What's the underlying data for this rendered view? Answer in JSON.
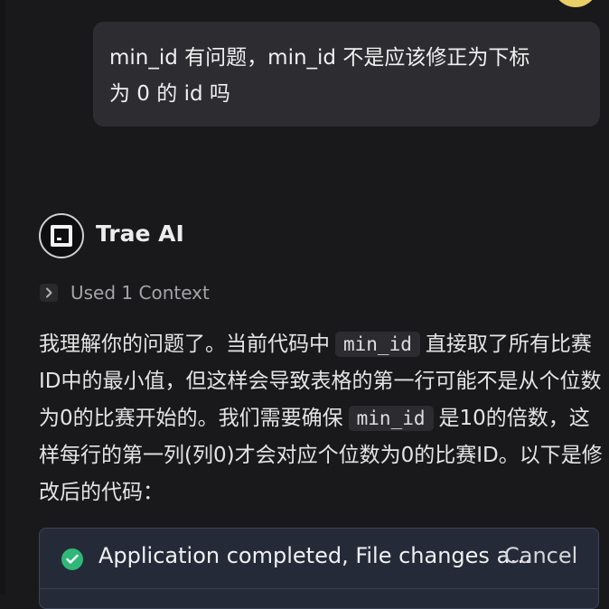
{
  "user_message": {
    "line1": "min_id 有问题，min_id 不是应该修正为下标",
    "line2": "为 0 的 id 吗"
  },
  "assistant": {
    "name": "Trae AI",
    "context_label": "Used 1 Context",
    "message": {
      "p1": "我理解你的问题了。当前代码中",
      "code1": "min_id",
      "p2": "直接取了所有比赛ID中的最小值，但这样会导致表格的第一行可能不是从个位数为0的比赛开始的。我们需要确保",
      "code2": "min_id",
      "p3": "是10的倍数，这样每行的第一列(列0)才会对应个位数为0的比赛ID。以下是修改后的代码："
    }
  },
  "status_card": {
    "text": "Application completed, File changes applied",
    "cancel_label": "Cancel",
    "status_color": "#2fb877"
  }
}
